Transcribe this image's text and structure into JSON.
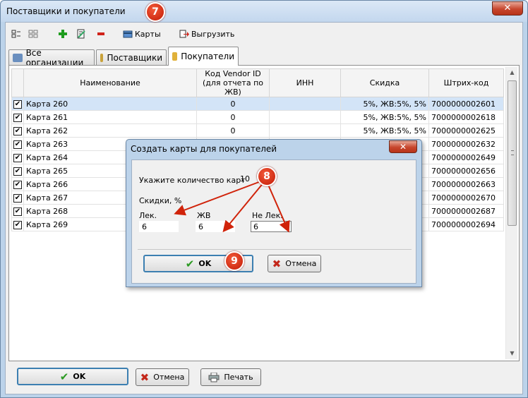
{
  "window": {
    "title": "Поставщики и покупатели",
    "close_glyph": "✕"
  },
  "toolbar": {
    "cards_label": "Карты",
    "export_label": "Выгрузить",
    "icons": [
      "select-all-icon",
      "deselect-icon",
      "add-icon",
      "edit-icon",
      "delete-icon",
      "cards-icon",
      "export-icon"
    ]
  },
  "tabs": [
    {
      "label": "Все организации",
      "icon": "truck-icon",
      "active": false
    },
    {
      "label": "Поставщики",
      "icon": "supplier-icon",
      "active": false
    },
    {
      "label": "Покупатели",
      "icon": "buyer-icon",
      "active": true
    }
  ],
  "grid": {
    "columns": [
      "Наименование",
      "Код Vendor ID (для отчета по ЖВ)",
      "ИНН",
      "Скидка",
      "Штрих-код"
    ],
    "rows": [
      {
        "checked": true,
        "name": "Карта 260",
        "vendor": "0",
        "inn": "",
        "discount": "5%, ЖВ:5%, 5%",
        "barcode": "7000000002601",
        "selected": true
      },
      {
        "checked": true,
        "name": "Карта 261",
        "vendor": "0",
        "inn": "",
        "discount": "5%, ЖВ:5%, 5%",
        "barcode": "7000000002618",
        "selected": false
      },
      {
        "checked": true,
        "name": "Карта 262",
        "vendor": "0",
        "inn": "",
        "discount": "5%, ЖВ:5%, 5%",
        "barcode": "7000000002625",
        "selected": false
      },
      {
        "checked": true,
        "name": "Карта 263",
        "vendor": "",
        "inn": "",
        "discount": "",
        "barcode": "7000000002632",
        "selected": false
      },
      {
        "checked": true,
        "name": "Карта 264",
        "vendor": "",
        "inn": "",
        "discount": "",
        "barcode": "7000000002649",
        "selected": false
      },
      {
        "checked": true,
        "name": "Карта 265",
        "vendor": "",
        "inn": "",
        "discount": "",
        "barcode": "7000000002656",
        "selected": false
      },
      {
        "checked": true,
        "name": "Карта 266",
        "vendor": "",
        "inn": "",
        "discount": "",
        "barcode": "7000000002663",
        "selected": false
      },
      {
        "checked": true,
        "name": "Карта 267",
        "vendor": "",
        "inn": "",
        "discount": "",
        "barcode": "7000000002670",
        "selected": false
      },
      {
        "checked": true,
        "name": "Карта 268",
        "vendor": "",
        "inn": "",
        "discount": "",
        "barcode": "7000000002687",
        "selected": false
      },
      {
        "checked": true,
        "name": "Карта 269",
        "vendor": "",
        "inn": "",
        "discount": "",
        "barcode": "7000000002694",
        "selected": false
      }
    ]
  },
  "footer": {
    "ok_label": "OK",
    "cancel_label": "Отмена",
    "print_label": "Печать"
  },
  "dialog": {
    "title": "Создать карты для покупателей",
    "close_glyph": "✕",
    "count_label": "Укажите количество карт",
    "count_value": "10",
    "discounts_label": "Скидки, %",
    "lek_label": "Лек.",
    "lek_value": "6",
    "zhv_label": "ЖВ",
    "zhv_value": "6",
    "nelek_label": "Не Лек.",
    "nelek_value": "6",
    "ok_label": "OK",
    "cancel_label": "Отмена"
  },
  "annotations": [
    "7",
    "8",
    "9"
  ],
  "colors": {
    "accent": "#3c7fb1",
    "badge": "#d0230a",
    "selected_row": "#d3e4f7",
    "ok_check": "#2b9a22",
    "cancel_x": "#c3271a"
  }
}
